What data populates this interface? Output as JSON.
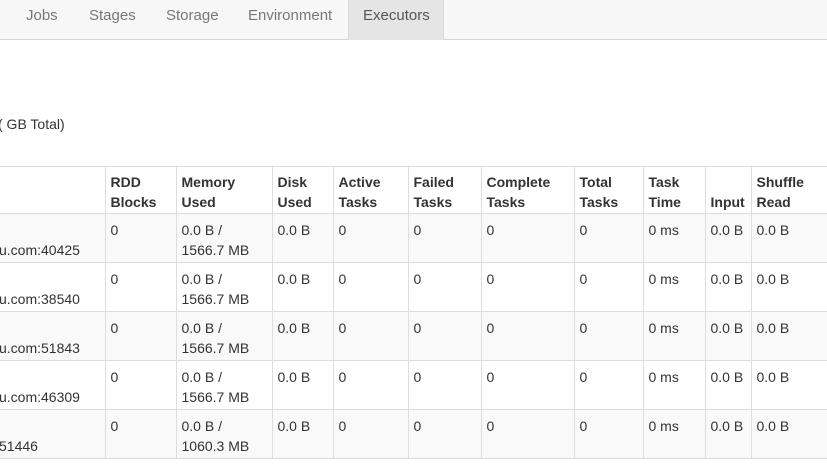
{
  "nav": {
    "tabs": [
      {
        "label": "Jobs"
      },
      {
        "label": "Stages"
      },
      {
        "label": "Storage"
      },
      {
        "label": "Environment"
      },
      {
        "label": "Executors",
        "active": true
      }
    ]
  },
  "summary": "(  GB Total)",
  "table": {
    "headers": [
      {
        "line1": "",
        "line2": ""
      },
      {
        "line1": "RDD",
        "line2": "Blocks"
      },
      {
        "line1": "Memory",
        "line2": "Used"
      },
      {
        "line1": "Disk",
        "line2": "Used"
      },
      {
        "line1": "Active",
        "line2": "Tasks"
      },
      {
        "line1": "Failed",
        "line2": "Tasks"
      },
      {
        "line1": "Complete",
        "line2": "Tasks"
      },
      {
        "line1": "Total",
        "line2": "Tasks"
      },
      {
        "line1": "Task",
        "line2": "Time"
      },
      {
        "line1": "",
        "line2": "Input"
      },
      {
        "line1": "Shuffle",
        "line2": "Read"
      }
    ],
    "rows": [
      {
        "address": "u.com:40425",
        "rdd_blocks": "0",
        "memory_used_1": "0.0 B /",
        "memory_used_2": "1566.7 MB",
        "disk_used": "0.0 B",
        "active_tasks": "0",
        "failed_tasks": "0",
        "complete_tasks": "0",
        "total_tasks": "0",
        "task_time": "0 ms",
        "input": "0.0 B",
        "shuffle_read": "0.0 B"
      },
      {
        "address": "u.com:38540",
        "rdd_blocks": "0",
        "memory_used_1": "0.0 B /",
        "memory_used_2": "1566.7 MB",
        "disk_used": "0.0 B",
        "active_tasks": "0",
        "failed_tasks": "0",
        "complete_tasks": "0",
        "total_tasks": "0",
        "task_time": "0 ms",
        "input": "0.0 B",
        "shuffle_read": "0.0 B"
      },
      {
        "address": "u.com:51843",
        "rdd_blocks": "0",
        "memory_used_1": "0.0 B /",
        "memory_used_2": "1566.7 MB",
        "disk_used": "0.0 B",
        "active_tasks": "0",
        "failed_tasks": "0",
        "complete_tasks": "0",
        "total_tasks": "0",
        "task_time": "0 ms",
        "input": "0.0 B",
        "shuffle_read": "0.0 B"
      },
      {
        "address": "u.com:46309",
        "rdd_blocks": "0",
        "memory_used_1": "0.0 B /",
        "memory_used_2": "1566.7 MB",
        "disk_used": "0.0 B",
        "active_tasks": "0",
        "failed_tasks": "0",
        "complete_tasks": "0",
        "total_tasks": "0",
        "task_time": "0 ms",
        "input": "0.0 B",
        "shuffle_read": "0.0 B"
      },
      {
        "address": "51446",
        "rdd_blocks": "0",
        "memory_used_1": "0.0 B /",
        "memory_used_2": "1060.3 MB",
        "disk_used": "0.0 B",
        "active_tasks": "0",
        "failed_tasks": "0",
        "complete_tasks": "0",
        "total_tasks": "0",
        "task_time": "0 ms",
        "input": "0.0 B",
        "shuffle_read": "0.0 B"
      }
    ]
  },
  "colors": {
    "navbar_bg": "#f7f7f7",
    "active_tab_bg": "#e5e5e5",
    "stripe": "#f9f9f9",
    "border": "#dddddd"
  }
}
